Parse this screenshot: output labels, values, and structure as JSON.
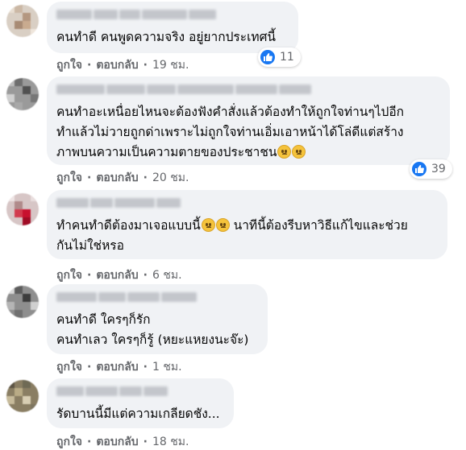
{
  "comments": [
    {
      "text": "คนทำดี คนพูดความจริง อยู่ยากประเทศนี้",
      "reactions": "11",
      "like": "ถูกใจ",
      "reply": "ตอบกลับ",
      "time": "19 ชม."
    },
    {
      "text": "คนทำอะเหนื่อยไหนจะต้องฟังคำสั่งแล้วต้องทำให้ถูกใจท่านๆไปอีก\nทำแล้วไม่วายถูกด่าเพราะไม่ถูกใจท่านเอิ่มเอาหน้าได้โล่ดีแต่สร้าง\nภาพบนความเป็นความตายของประชาชน",
      "reactions": "39",
      "like": "ถูกใจ",
      "reply": "ตอบกลับ",
      "time": "20 ชม."
    },
    {
      "text_a": "ทำคนทำดีต้องมาเจอแบบนี้",
      "text_b": " นาทีนี้ต้องรีบหาวิธีแก้ไขและช่วย\nกันไม่ใช่หรอ",
      "like": "ถูกใจ",
      "reply": "ตอบกลับ",
      "time": "6 ชม."
    },
    {
      "text": "คนทำดี ใครๆก็รัก\nคนทำเลว ใครๆก็รู้ (หยะแหยงนะจ๊ะ)",
      "like": "ถูกใจ",
      "reply": "ตอบกลับ",
      "time": "1 ชม."
    },
    {
      "text": "รัดบานนี้มีแต่ความเกลียดชัง...",
      "like": "ถูกใจ",
      "reply": "ตอบกลับ",
      "time": "18 ชม."
    }
  ],
  "colors": {
    "bubble": "#f0f2f5",
    "meta": "#65676b",
    "like_blue": "#1877f2"
  },
  "icons": {
    "reaction": "thumbs-up-icon",
    "emoji": "sad-face-emoji-icon"
  }
}
